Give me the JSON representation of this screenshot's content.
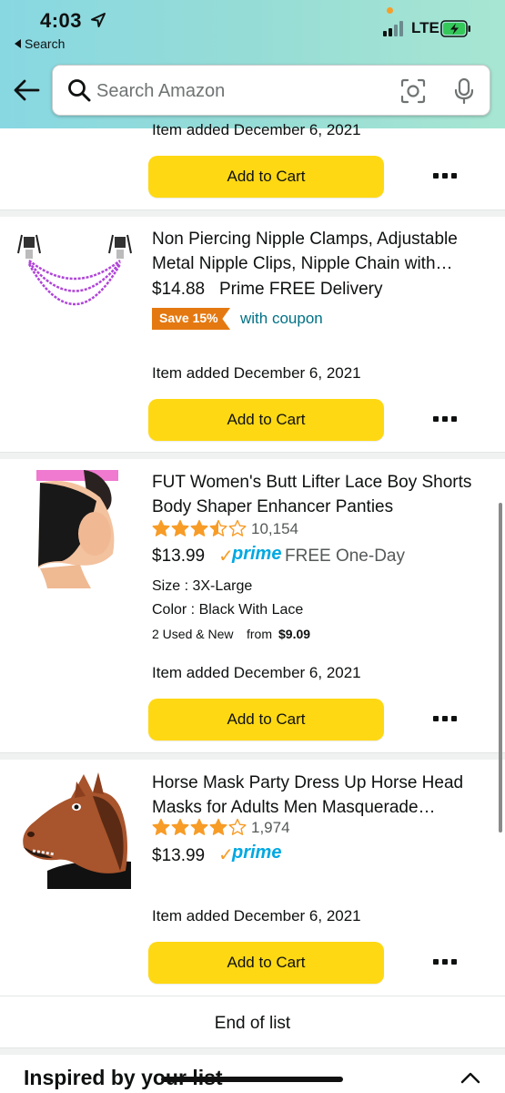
{
  "status_bar": {
    "time": "4:03",
    "back_label": "Search",
    "network": "LTE"
  },
  "search": {
    "placeholder": "Search Amazon"
  },
  "items": [
    {
      "added": "Item added December 6, 2021",
      "add_button": "Add to Cart"
    },
    {
      "title_line1": "Non Piercing Nipple Clamps, Adjustable",
      "title_line2": "Metal Nipple Clips, Nipple Chain with…",
      "price": "$14.88",
      "delivery": "Prime FREE Delivery",
      "coupon_badge": "Save 15%",
      "coupon_text": "with coupon",
      "added": "Item added December 6, 2021",
      "add_button": "Add to Cart"
    },
    {
      "title_line1": "FUT Women's Butt Lifter Lace Boy Shorts",
      "title_line2": "Body Shaper Enhancer Panties",
      "rating": 3.5,
      "rating_count": "10,154",
      "price": "$13.99",
      "prime_label": "prime",
      "prime_shipping": "FREE One-Day",
      "size": "Size : 3X-Large",
      "color": "Color : Black With Lace",
      "used_new": "2 Used & New",
      "used_from_label": "from",
      "used_from_price": "$9.09",
      "added": "Item added December 6, 2021",
      "add_button": "Add to Cart"
    },
    {
      "title_line1": "Horse Mask Party Dress Up Horse Head",
      "title_line2": "Masks for Adults Men Masquerade…",
      "rating": 4,
      "rating_count": "1,974",
      "price": "$13.99",
      "prime_label": "prime",
      "added": "Item added December 6, 2021",
      "add_button": "Add to Cart"
    }
  ],
  "footer": {
    "end_of_list": "End of list",
    "inspired": "Inspired by your list"
  },
  "colors": {
    "header_gradient_start": "#88d8e2",
    "header_gradient_end": "#a7e6d2",
    "add_to_cart": "#fed813",
    "coupon_badge": "#e47911",
    "link_teal": "#007185",
    "prime_blue": "#00a8e1",
    "star_orange": "#f79c27"
  },
  "icons": [
    "location-arrow-icon",
    "signal-icon",
    "battery-charging-icon",
    "back-arrow-icon",
    "search-icon",
    "camera-scan-icon",
    "microphone-icon",
    "more-options-icon",
    "star-icon",
    "chevron-up-icon"
  ]
}
